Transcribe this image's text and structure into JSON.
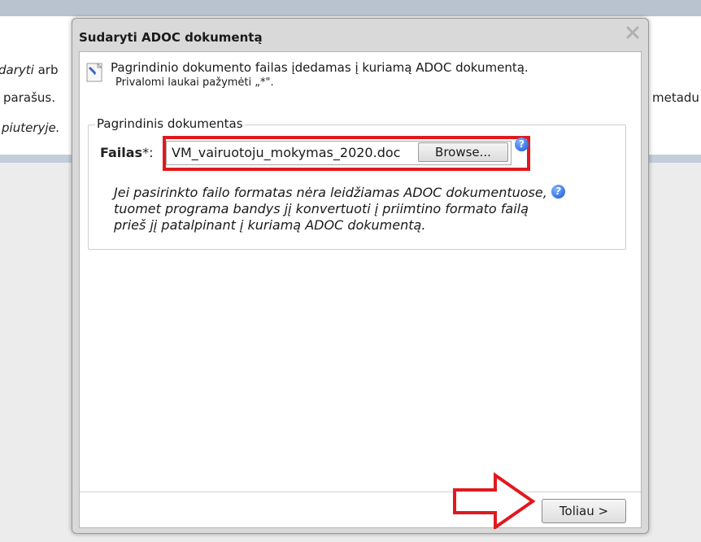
{
  "background": {
    "line1_italic": "daryti",
    "line1_rest": " arb",
    "line2": "parašus.",
    "line3_italic": "piuteryje.",
    "right_text": "metadu"
  },
  "dialog": {
    "title": "Sudaryti ADOC dokumentą",
    "close_icon": "close-icon",
    "info_text": "Pagrindinio dokumento failas įdedamas į kuriamą ADOC dokumentą.",
    "required_note": "Privalomi laukai pažymėti „*\".",
    "fieldset_legend": "Pagrindinis dokumentas",
    "file_label": "Failas",
    "file_label_suffix": "*:",
    "file_value": "VM_vairuotoju_mokymas_2020.doc",
    "browse_label": "Browse...",
    "note_lines": [
      "Jei pasirinkto failo formatas nėra leidžiamas ADOC dokumentuose,",
      "tuomet programa bandys jį konvertuoti į priimtino formato failą",
      "prieš jį patalpinant į kuriamą ADOC dokumentą."
    ],
    "next_label": "Toliau >"
  },
  "colors": {
    "highlight": "#e1191e",
    "help_icon": "#1558d6"
  }
}
